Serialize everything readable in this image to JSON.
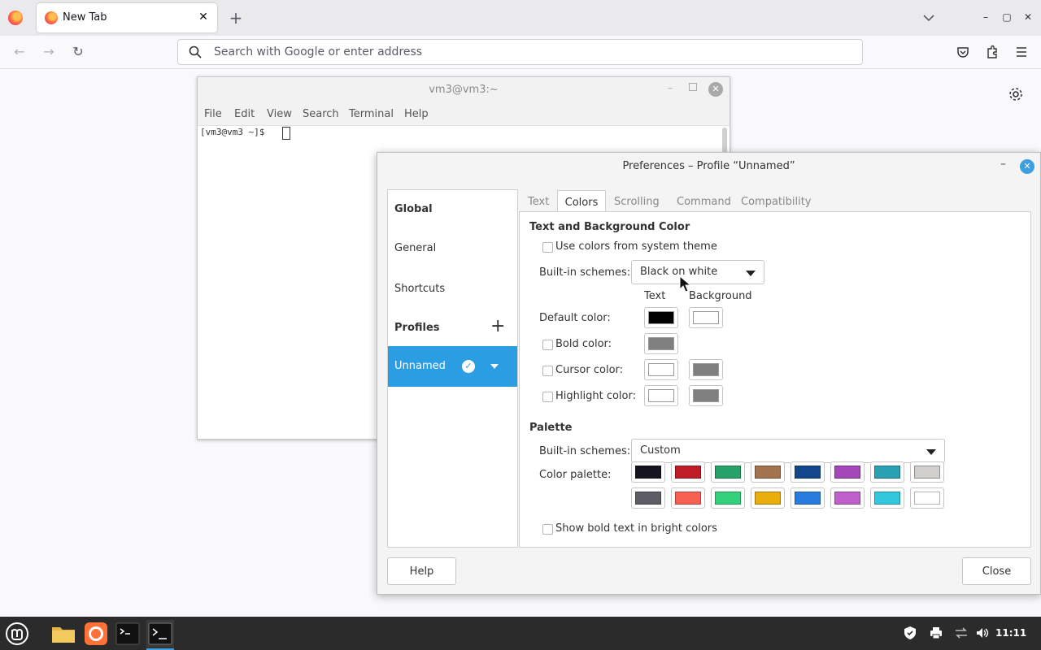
{
  "browser": {
    "tab_title": "New Tab",
    "tab_close": "✕",
    "new_tab": "+",
    "address_placeholder": "Search with Google or enter address",
    "window_controls": {
      "minimize": "–",
      "maximize": "▢",
      "close": "✕"
    }
  },
  "terminal": {
    "title": "vm3@vm3:~",
    "menu": [
      "File",
      "Edit",
      "View",
      "Search",
      "Terminal",
      "Help"
    ],
    "prompt": "[vm3@vm3 ~]$ "
  },
  "prefs": {
    "title": "Preferences – Profile “Unnamed”",
    "sidebar": {
      "global": "Global",
      "general": "General",
      "shortcuts": "Shortcuts",
      "profiles": "Profiles",
      "add": "+",
      "selected_profile": "Unnamed"
    },
    "tabs": [
      "Text",
      "Colors",
      "Scrolling",
      "Command",
      "Compatibility"
    ],
    "active_tab": "Colors",
    "section_text_bg": "Text and Background Color",
    "use_system_colors": "Use colors from system theme",
    "builtin_label": "Built-in schemes:",
    "builtin_value": "Black on white",
    "col_text": "Text",
    "col_background": "Background",
    "default_color": "Default color:",
    "bold_color": "Bold color:",
    "cursor_color": "Cursor color:",
    "highlight_color": "Highlight color:",
    "swatches": {
      "default_text": "#000000",
      "default_bg": "#ffffff",
      "bold": "#808080",
      "cursor_text": "#ffffff",
      "cursor_bg": "#808080",
      "highlight_text": "#ffffff",
      "highlight_bg": "#808080"
    },
    "section_palette": "Palette",
    "palette_builtin_label": "Built-in schemes:",
    "palette_builtin_value": "Custom",
    "color_palette_label": "Color palette:",
    "palette_row1": [
      "#171421",
      "#c01c28",
      "#26a269",
      "#a2734c",
      "#12488b",
      "#a347ba",
      "#2aa1b3",
      "#d0cfcc"
    ],
    "palette_row2": [
      "#5e5c64",
      "#f66151",
      "#33d17a",
      "#e9ad0c",
      "#2a7bde",
      "#c061cb",
      "#33c7de",
      "#ffffff"
    ],
    "show_bold_bright": "Show bold text in bright colors",
    "help": "Help",
    "close": "Close"
  },
  "taskbar": {
    "clock": "11:11"
  }
}
